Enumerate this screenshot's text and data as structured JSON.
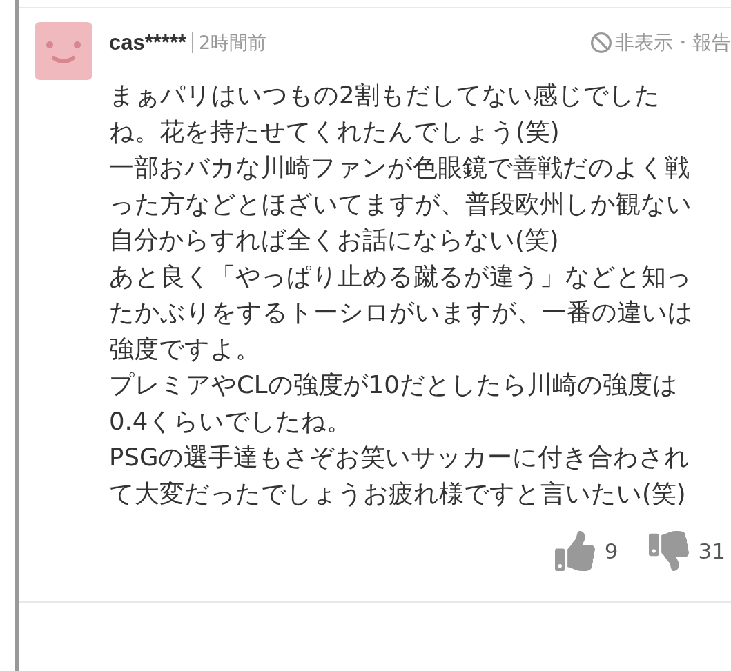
{
  "comment": {
    "user": "cas*****",
    "time": "2時間前",
    "hide_report": "非表示・報告",
    "lines": [
      "まぁパリはいつもの2割もだしてない感じでした",
      "ね。花を持たせてくれたんでしょう(笑)",
      "一部おバカな川崎ファンが色眼鏡で善戦だのよく戦",
      "った方などとほざいてますが、普段欧州しか観ない",
      "自分からすれば全くお話にならない(笑)",
      "あと良く「やっぱり止める蹴るが違う」などと知っ",
      "たかぶりをするトーシロがいますが、一番の違いは",
      "強度ですよ。",
      "プレミアやCLの強度が10だとしたら川崎の強度は",
      "0.4くらいでしたね。",
      "PSGの選手達もさぞお笑いサッカーに付き合わされ",
      "て大変だったでしょうお疲れ様ですと言いたい(笑)"
    ],
    "likes": "9",
    "dislikes": "31"
  }
}
